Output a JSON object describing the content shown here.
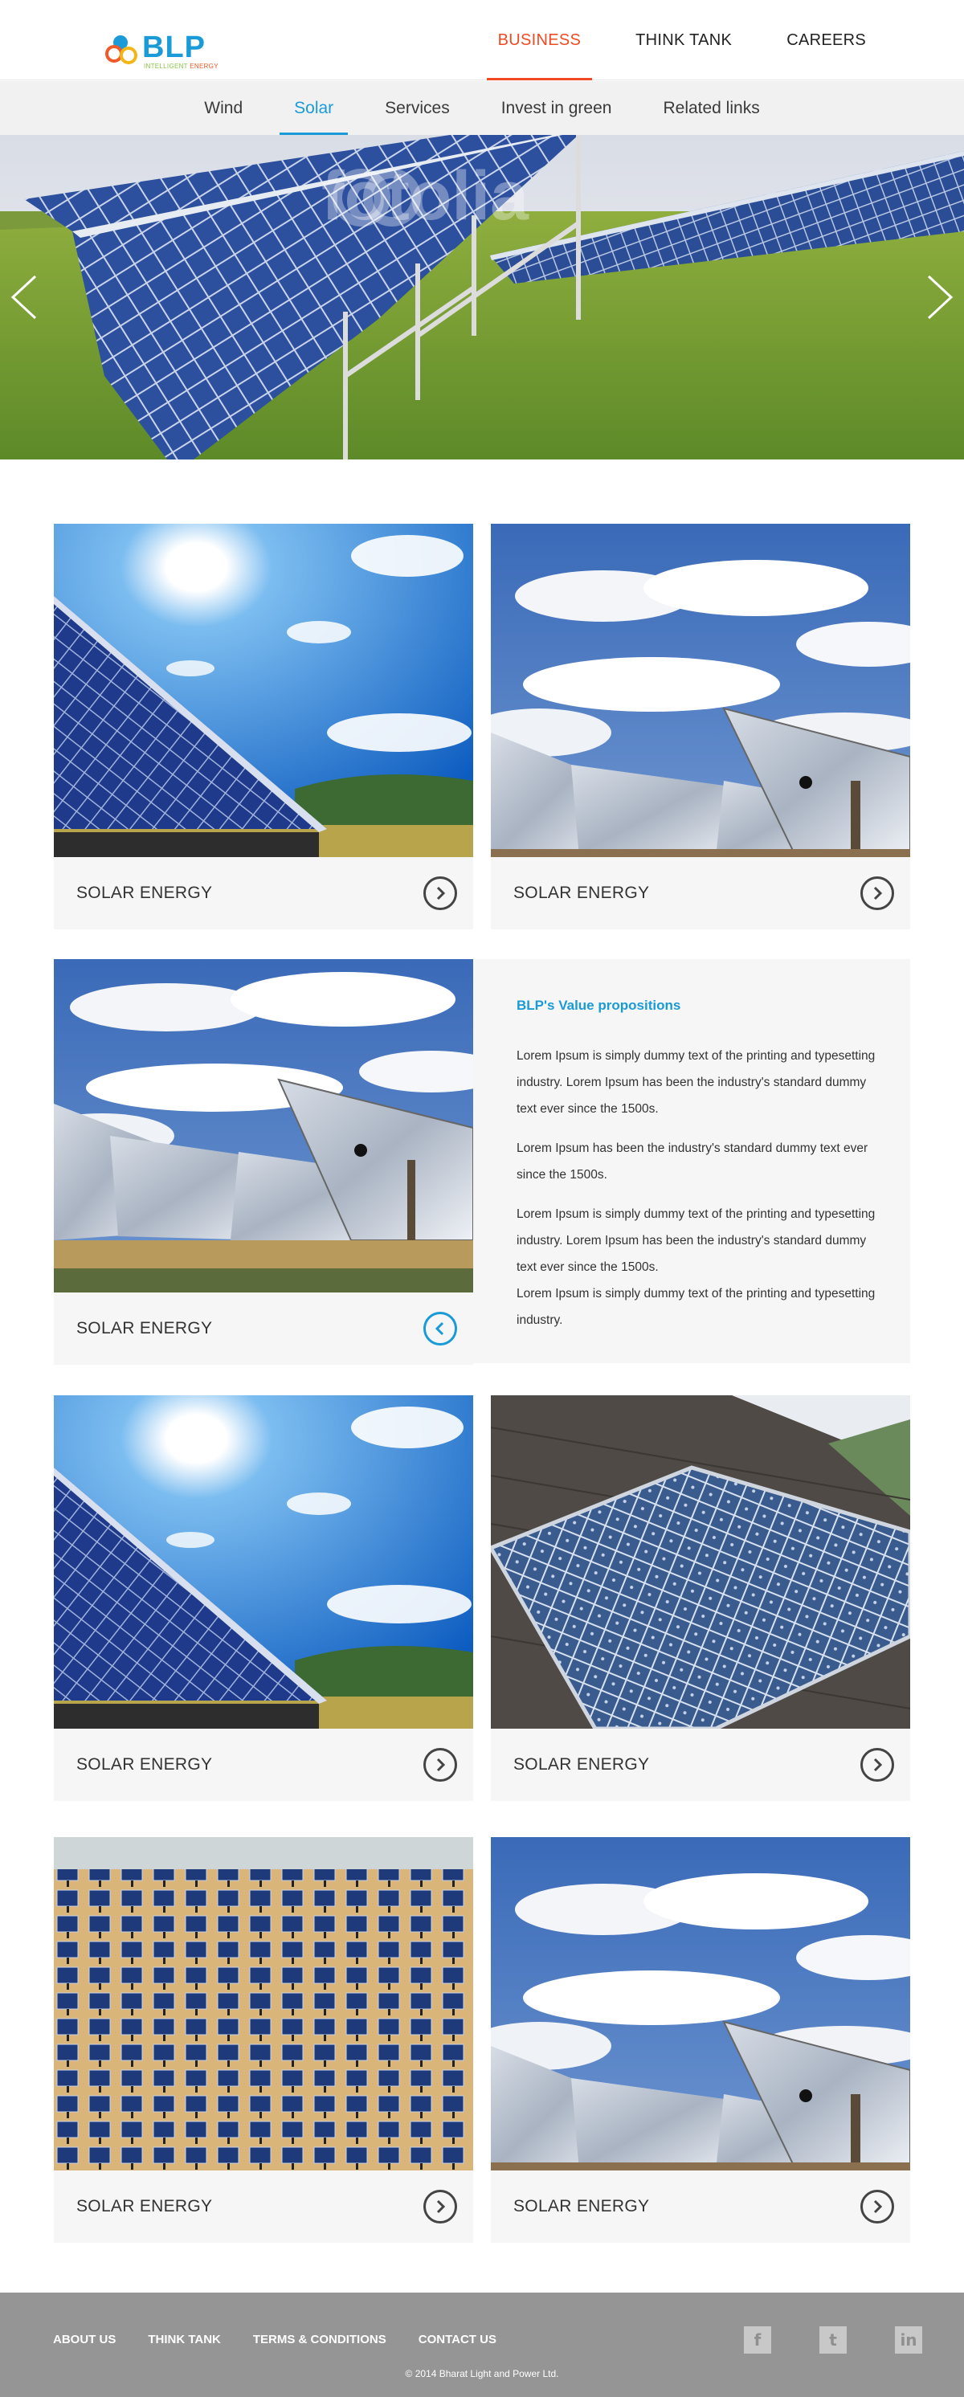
{
  "brand": {
    "name": "BLP",
    "tagline_a": "INTELLIGENT",
    "tagline_b": " ENERGY",
    "colors": {
      "blue": "#1a9bd7",
      "orange": "#ef4a23",
      "yellow": "#f2b616"
    }
  },
  "main_nav": [
    {
      "label": "BUSINESS",
      "active": true
    },
    {
      "label": "THINK TANK",
      "active": false
    },
    {
      "label": "CAREERS",
      "active": false
    }
  ],
  "sub_nav": [
    {
      "label": "Wind",
      "active": false
    },
    {
      "label": "Solar",
      "active": true
    },
    {
      "label": "Services",
      "active": false
    },
    {
      "label": "Invest in green",
      "active": false
    },
    {
      "label": "Related links",
      "active": false
    }
  ],
  "hero": {
    "watermark": "fotolia",
    "prev_icon": "chevron-left-icon",
    "next_icon": "chevron-right-icon"
  },
  "cards": [
    {
      "caption": "SOLAR ENERGY",
      "photo": "sun-panels",
      "arrow": "right"
    },
    {
      "caption": "SOLAR ENERGY",
      "photo": "mirror-panels",
      "arrow": "right"
    },
    {
      "caption": "SOLAR ENERGY",
      "photo": "mirror-panels",
      "arrow": "left"
    },
    {
      "caption": "SOLAR ENERGY",
      "photo": "sun-panels",
      "arrow": "right"
    },
    {
      "caption": "SOLAR ENERGY",
      "photo": "roof-panels",
      "arrow": "right"
    },
    {
      "caption": "SOLAR ENERGY",
      "photo": "desert-field",
      "arrow": "right"
    },
    {
      "caption": "SOLAR ENERGY",
      "photo": "mirror-panels",
      "arrow": "right"
    }
  ],
  "info": {
    "title": "BLP's Value propositions",
    "p1": "Lorem Ipsum is simply dummy text of the printing and typesetting industry. Lorem Ipsum has been the industry's standard dummy text ever since the 1500s.",
    "p2": "Lorem Ipsum has been the industry's standard dummy text ever since the 1500s.",
    "p3": "Lorem Ipsum is simply dummy text of the printing and typesetting industry. Lorem Ipsum has been the industry's standard dummy text ever since the 1500s.",
    "p4": "Lorem Ipsum is simply dummy text of the printing and typesetting industry."
  },
  "footer": {
    "links": [
      "ABOUT US",
      "THINK TANK",
      "TERMS & CONDITIONS",
      "CONTACT US"
    ],
    "social": [
      {
        "glyph": "f",
        "icon": "facebook-icon"
      },
      {
        "glyph": "t",
        "icon": "twitter-icon"
      },
      {
        "glyph": "in",
        "icon": "linkedin-icon"
      }
    ],
    "copyright": "© 2014 Bharat Light and Power Ltd."
  }
}
